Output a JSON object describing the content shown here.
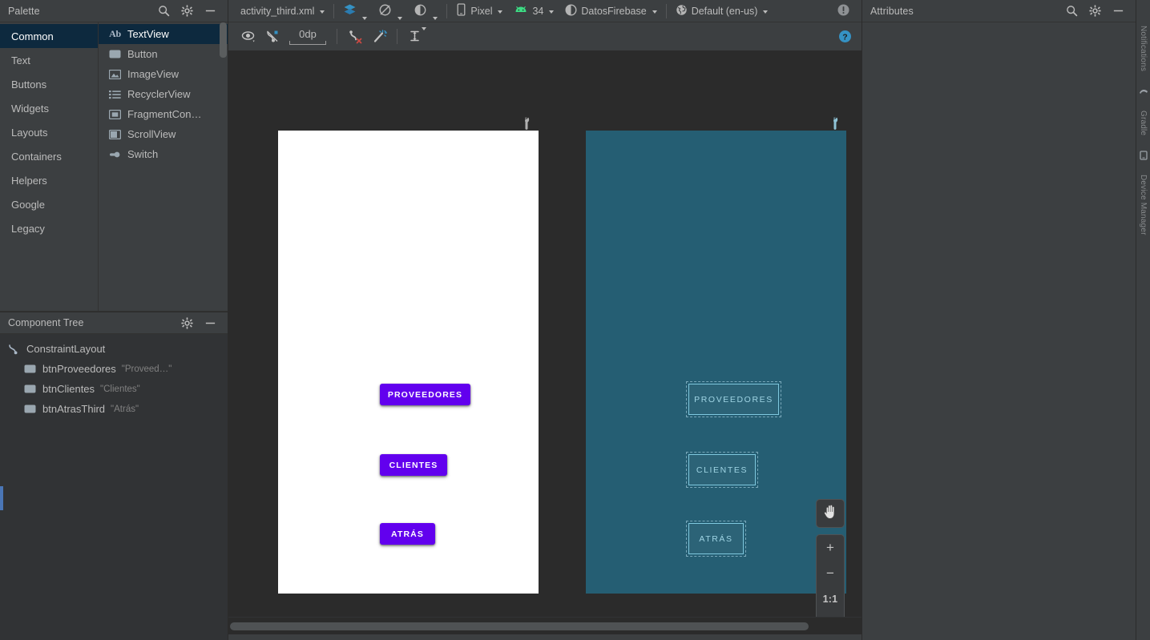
{
  "palette": {
    "title": "Palette",
    "search_icon": "search-icon",
    "settings_icon": "gear-icon",
    "minimize_icon": "minimize-icon",
    "categories": [
      {
        "label": "Common",
        "selected": true
      },
      {
        "label": "Text",
        "selected": false
      },
      {
        "label": "Buttons",
        "selected": false
      },
      {
        "label": "Widgets",
        "selected": false
      },
      {
        "label": "Layouts",
        "selected": false
      },
      {
        "label": "Containers",
        "selected": false
      },
      {
        "label": "Helpers",
        "selected": false
      },
      {
        "label": "Google",
        "selected": false
      },
      {
        "label": "Legacy",
        "selected": false
      }
    ],
    "items": [
      {
        "label": "TextView",
        "icon": "textview-icon",
        "selected": true
      },
      {
        "label": "Button",
        "icon": "button-icon",
        "selected": false
      },
      {
        "label": "ImageView",
        "icon": "imageview-icon",
        "selected": false
      },
      {
        "label": "RecyclerView",
        "icon": "recyclerview-icon",
        "selected": false
      },
      {
        "label": "FragmentCon…",
        "icon": "fragment-container-icon",
        "selected": false
      },
      {
        "label": "ScrollView",
        "icon": "scrollview-icon",
        "selected": false
      },
      {
        "label": "Switch",
        "icon": "switch-icon",
        "selected": false
      }
    ]
  },
  "component_tree": {
    "title": "Component Tree",
    "settings_icon": "gear-icon",
    "minimize_icon": "minimize-icon",
    "root": {
      "label": "ConstraintLayout",
      "icon": "constraintlayout-icon"
    },
    "children": [
      {
        "label": "btnProveedores",
        "text": "\"Proveed…\"",
        "icon": "button-icon"
      },
      {
        "label": "btnClientes",
        "text": "\"Clientes\"",
        "icon": "button-icon"
      },
      {
        "label": "btnAtrasThird",
        "text": "\"Atrás\"",
        "icon": "button-icon"
      }
    ]
  },
  "top_bar": {
    "file_name": "activity_third.xml",
    "layers_icon": "layers-icon",
    "orientation_icon": "rotate-device-icon",
    "theme_icon": "night-mode-icon",
    "device": {
      "icon": "phone-icon",
      "label": "Pixel"
    },
    "api": {
      "icon": "android-icon",
      "label": "34"
    },
    "theme": {
      "icon": "theme-icon",
      "label": "DatosFirebase"
    },
    "locale": {
      "icon": "globe-icon",
      "label": "Default (en-us)"
    },
    "notification_icon": "warning-icon"
  },
  "tool_bar": {
    "visibility_icon": "eye-icon",
    "clear_constraints_icon": "clear-constraints-icon",
    "default_margin_label": "0dp",
    "no_autoconnect_icon": "autoconnect-off-icon",
    "infer_constraints_icon": "magic-wand-icon",
    "guidelines_icon": "guidelines-icon",
    "help_icon": "help-icon"
  },
  "design_surface": {
    "device_wrench_icon": "wrench-icon",
    "blueprint_wrench_icon": "wrench-icon",
    "resize_handle_icon": "resize-handle-icon",
    "buttons": [
      {
        "label": "PROVEEDORES"
      },
      {
        "label": "CLIENTES"
      },
      {
        "label": "ATRÁS"
      }
    ],
    "colors": {
      "button_background": "#6200ee",
      "button_text": "#ffffff",
      "blueprint_background": "#255e73",
      "blueprint_outline": "#7fc8df",
      "canvas_background": "#2b2b2b"
    },
    "zoom_controls": {
      "pan_icon": "hand-icon",
      "zoom_in_label": "+",
      "zoom_out_label": "−",
      "zoom_reset_label": "1:1",
      "zoom_fit_icon": "zoom-to-fit-icon"
    }
  },
  "attributes": {
    "title": "Attributes",
    "search_icon": "search-icon",
    "settings_icon": "gear-icon",
    "minimize_icon": "minimize-icon"
  },
  "right_tool_strip": {
    "items": [
      {
        "label": "Notifications",
        "icon": "bell-icon"
      },
      {
        "label": "Gradle",
        "icon": "gradle-icon"
      },
      {
        "label": "Device Manager",
        "icon": "device-manager-icon"
      }
    ]
  }
}
